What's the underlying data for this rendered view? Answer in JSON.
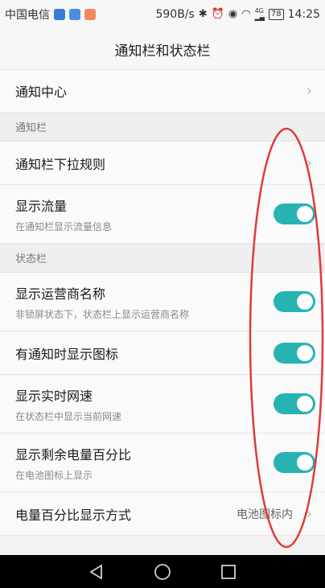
{
  "status_bar": {
    "carrier": "中国电信",
    "speed": "590B/s",
    "network": "4G",
    "battery": "78",
    "time": "14:25"
  },
  "header": {
    "title": "通知栏和状态栏"
  },
  "rows": {
    "notification_center": {
      "title": "通知中心"
    },
    "section_notification": "通知栏",
    "pulldown_rule": {
      "title": "通知栏下拉规则"
    },
    "show_traffic": {
      "title": "显示流量",
      "subtitle": "在通知栏显示流量信息",
      "on": true
    },
    "section_status": "状态栏",
    "show_carrier": {
      "title": "显示运营商名称",
      "subtitle": "非锁屏状态下，状态栏上显示运营商名称",
      "on": true
    },
    "notif_icons": {
      "title": "有通知时显示图标",
      "on": true
    },
    "net_speed": {
      "title": "显示实时网速",
      "subtitle": "在状态栏中显示当前网速",
      "on": true
    },
    "battery_percent": {
      "title": "显示剩余电量百分比",
      "subtitle": "在电池图标上显示",
      "on": true
    },
    "percent_mode": {
      "title": "电量百分比显示方式",
      "value": "电池图标内"
    }
  },
  "colors": {
    "accent": "#27b3b2",
    "annotation": "#e03a3a"
  },
  "icons": [
    "back-icon",
    "home-icon",
    "recents-icon",
    "bluetooth-icon",
    "alarm-icon",
    "eye-icon",
    "wifi-icon",
    "battery-icon"
  ]
}
